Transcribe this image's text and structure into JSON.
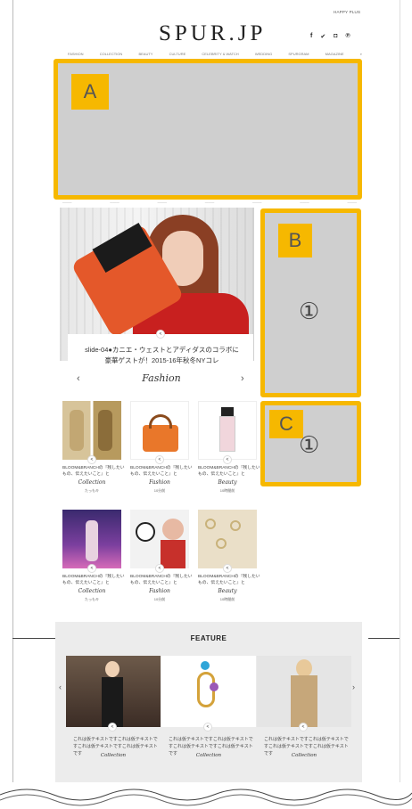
{
  "header": {
    "top_link": "HAPPY PLUS",
    "logo": "SPUR.JP",
    "social_icons": [
      "facebook-icon",
      "twitter-icon",
      "instagram-icon",
      "pinterest-icon"
    ],
    "social_glyphs": [
      "f",
      "✔",
      "◘",
      "℗"
    ],
    "nav": [
      "FASHION",
      "COLLECTION",
      "BEAUTY",
      "CULTURE",
      "CELEBRITY & WATCH",
      "WEDDING",
      "SPURGRAM",
      "MAGAZINE",
      "⌕"
    ]
  },
  "placeholders": {
    "a": {
      "label": "A"
    },
    "b": {
      "label": "B",
      "number": "①"
    },
    "c": {
      "label": "C",
      "number": "①"
    }
  },
  "hero": {
    "caption": "slide-04●カニエ・ウェストとアディダスのコラボに豪華ゲストが！2015-16年秋冬NYコレ",
    "category": "Fashion",
    "prev": "‹",
    "next": "›",
    "share": "<"
  },
  "grid": [
    {
      "text": "BLOOM&BRANCHの『残したいもの、伝えたいこと』と",
      "category": "Collection",
      "author": "たっもキ"
    },
    {
      "text": "BLOOM&BRANCHの『残したいもの、伝えたいこと』と",
      "category": "Fashion",
      "author": "10分前"
    },
    {
      "text": "BLOOM&BRANCHの『残したいもの、伝えたいこと』と",
      "category": "Beauty",
      "author": "10時間前"
    },
    {
      "text": "BLOOM&BRANCHの『残したいもの、伝えたいこと』と",
      "category": "Collection",
      "author": "たっもキ"
    },
    {
      "text": "BLOOM&BRANCHの『残したいもの、伝えたいこと』と",
      "category": "Fashion",
      "author": "10分前"
    },
    {
      "text": "BLOOM&BRANCHの『残したいもの、伝えたいこと』と",
      "category": "Beauty",
      "author": "10時間前"
    }
  ],
  "feature": {
    "title": "FEATURE",
    "prev": "‹",
    "next": "›",
    "items": [
      {
        "text": "これは仮テキストですこれは仮テキストですこれは仮テキストですこれは仮テキストです",
        "category": "Collection"
      },
      {
        "text": "これは仮テキストですこれは仮テキストですこれは仮テキストですこれは仮テキストです",
        "category": "Collection"
      },
      {
        "text": "これは仮テキストですこれは仮テキストですこれは仮テキストですこれは仮テキストです",
        "category": "Collection"
      }
    ]
  },
  "colors": {
    "placeholder_border": "#f6b800",
    "placeholder_fill": "#cfcfcf",
    "feature_bg": "#ececec"
  }
}
